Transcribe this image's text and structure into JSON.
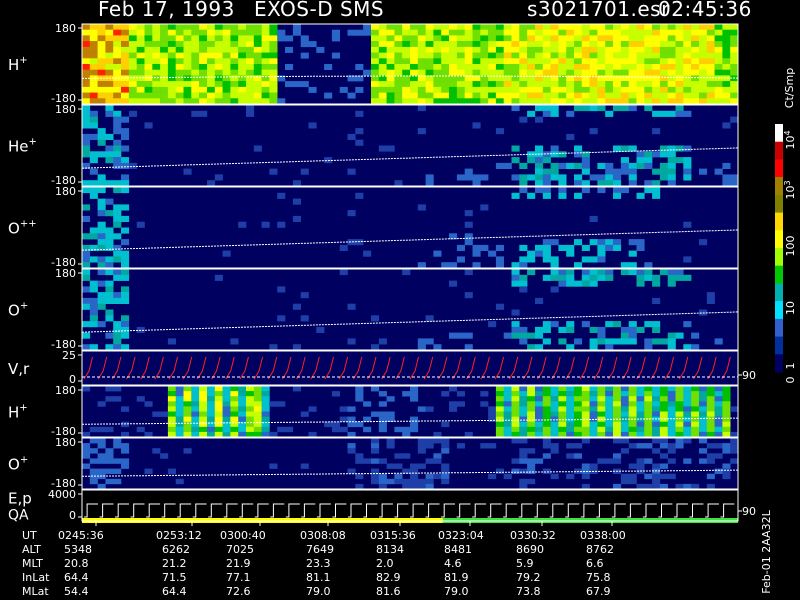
{
  "header": {
    "date": "Feb 17, 1993",
    "instrument": "EXOS-D SMS",
    "file": "s3021701.esr",
    "time": "02:45:36"
  },
  "panels": [
    {
      "id": "p1",
      "label": "H",
      "sup": "+",
      "ymax": "180",
      "ymin": "-180",
      "activity": "H1"
    },
    {
      "id": "p2",
      "label": "He",
      "sup": "+",
      "ymax": "180",
      "ymin": "-180",
      "activity": "HE"
    },
    {
      "id": "p3",
      "label": "O",
      "sup": "++",
      "ymax": "180",
      "ymin": "-180",
      "activity": "OPP"
    },
    {
      "id": "p4",
      "label": "O",
      "sup": "+",
      "ymax": "180",
      "ymin": "-180",
      "activity": "OP1"
    },
    {
      "id": "p5",
      "label": "V,r",
      "sup": "",
      "ymax": "25",
      "ymin": "0",
      "right_tick": "90",
      "activity": "VR"
    },
    {
      "id": "p6",
      "label": "H",
      "sup": "+",
      "ymax": "180",
      "ymin": "-180",
      "activity": "H2"
    },
    {
      "id": "p7",
      "label": "O",
      "sup": "+",
      "ymax": "180",
      "ymin": "-180",
      "activity": "OP2"
    },
    {
      "id": "p8",
      "label": "E,p",
      "label2": "QA",
      "sup": "",
      "ymax": "4000",
      "ymin": "0",
      "right_tick": "90",
      "activity": "EP"
    }
  ],
  "colorbar": {
    "unit": "Ct/Smp",
    "labels": [
      "10^4",
      "10^3",
      "100",
      "10",
      "1",
      "0"
    ],
    "colors": [
      "#ffffff",
      "#c80000",
      "#ff0000",
      "#a08000",
      "#808000",
      "#ffd700",
      "#ffff00",
      "#a0ff00",
      "#00c800",
      "#00b0b0",
      "#00e0ff",
      "#3060d0",
      "#0030a0",
      "#000060"
    ]
  },
  "footer": {
    "side_label": "Feb-01 2AA32L",
    "rows": [
      {
        "name": "UT",
        "values": [
          "0245:36",
          "0253:12",
          "0300:40",
          "0308:08",
          "0315:36",
          "0323:04",
          "0330:32",
          "0338:00"
        ]
      },
      {
        "name": "ALT",
        "values": [
          "5348",
          "6262",
          "7025",
          "7649",
          "8134",
          "8481",
          "8690",
          "8762"
        ]
      },
      {
        "name": "MLT",
        "values": [
          "20.8",
          "21.2",
          "21.9",
          "23.3",
          "2.0",
          "4.6",
          "5.9",
          "6.6"
        ]
      },
      {
        "name": "InLat",
        "values": [
          "64.4",
          "71.5",
          "77.1",
          "81.1",
          "82.9",
          "81.9",
          "79.2",
          "75.8"
        ]
      },
      {
        "name": "MLat",
        "values": [
          "54.4",
          "64.4",
          "72.6",
          "79.0",
          "81.6",
          "79.0",
          "73.8",
          "67.9"
        ]
      }
    ]
  }
}
